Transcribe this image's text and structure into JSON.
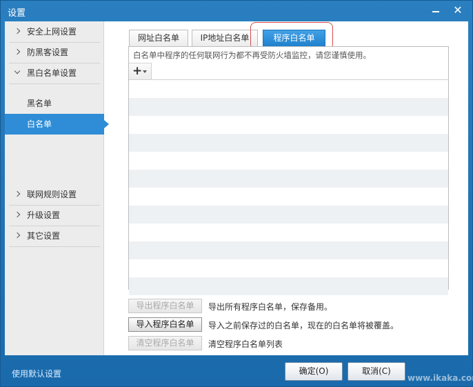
{
  "window": {
    "title": "设置"
  },
  "sidebar": {
    "items": [
      {
        "label": "安全上网设置"
      },
      {
        "label": "防黑客设置"
      },
      {
        "label": "黑白名单设置"
      },
      {
        "label": "联网规则设置"
      },
      {
        "label": "升级设置"
      },
      {
        "label": "其它设置"
      }
    ],
    "subitems": [
      {
        "label": "黑名单"
      },
      {
        "label": "白名单"
      }
    ]
  },
  "tabs": [
    {
      "label": "网址白名单"
    },
    {
      "label": "IP地址白名单"
    },
    {
      "label": "程序白名单"
    }
  ],
  "panel": {
    "description": "白名单中程序的任何联网行为都不再受防火墙监控，请您谨慎使用。"
  },
  "actions": [
    {
      "button": "导出程序白名单",
      "text": "导出所有程序白名单，保存备用。"
    },
    {
      "button": "导入程序白名单",
      "text": "导入之前保存过的白名单，现在的白名单将被覆盖。"
    },
    {
      "button": "清空程序白名单",
      "text": "清空程序白名单列表"
    }
  ],
  "footer": {
    "defaults": "使用默认设置",
    "ok": "确定(O)",
    "cancel": "取消(C)",
    "watermark": "www.ikaka.com"
  }
}
